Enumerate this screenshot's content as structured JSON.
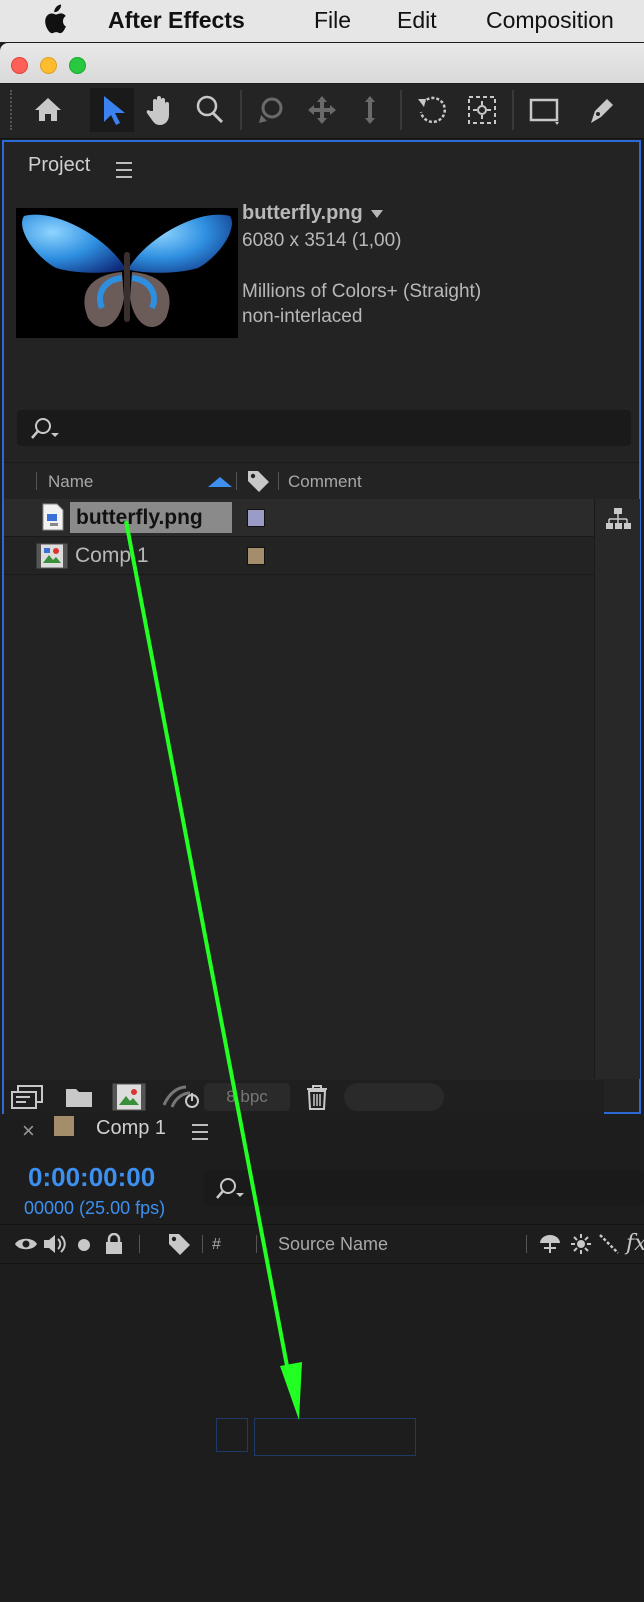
{
  "menubar": {
    "items": [
      "After Effects",
      "File",
      "Edit",
      "Composition"
    ]
  },
  "toolbar": {
    "tools": [
      "home-icon",
      "selection-tool-icon",
      "hand-tool-icon",
      "zoom-tool-icon",
      "orbit-camera-icon",
      "pan-camera-icon",
      "dolly-camera-icon",
      "rotation-tool-icon",
      "pan-behind-icon",
      "rectangle-tool-icon",
      "pen-tool-icon"
    ],
    "active_tool": "selection-tool-icon"
  },
  "project": {
    "title": "Project",
    "preview": {
      "filename": "butterfly.png",
      "dimensions": "6080 x 3514 (1,00)",
      "colors": "Millions of Colors+ (Straight)",
      "interlace": "non-interlaced"
    },
    "columns": {
      "name": "Name",
      "comment": "Comment"
    },
    "items": [
      {
        "name": "butterfly.png",
        "label_color": "#9b9bc8",
        "selected": true
      },
      {
        "name": "Comp 1",
        "label_color": "#a48d6b",
        "selected": false
      }
    ],
    "footer": {
      "bpc": "8 bpc"
    }
  },
  "timeline": {
    "tab_label": "Comp 1",
    "tab_color": "#a48d6b",
    "timecode": "0:00:00:00",
    "frames": "00000 (25.00 fps)",
    "columns": {
      "number": "#",
      "source_name": "Source Name"
    }
  },
  "colors": {
    "accent": "#2d6ad6",
    "timecode": "#3d8ff0",
    "drag_arrow": "#22ff22"
  }
}
